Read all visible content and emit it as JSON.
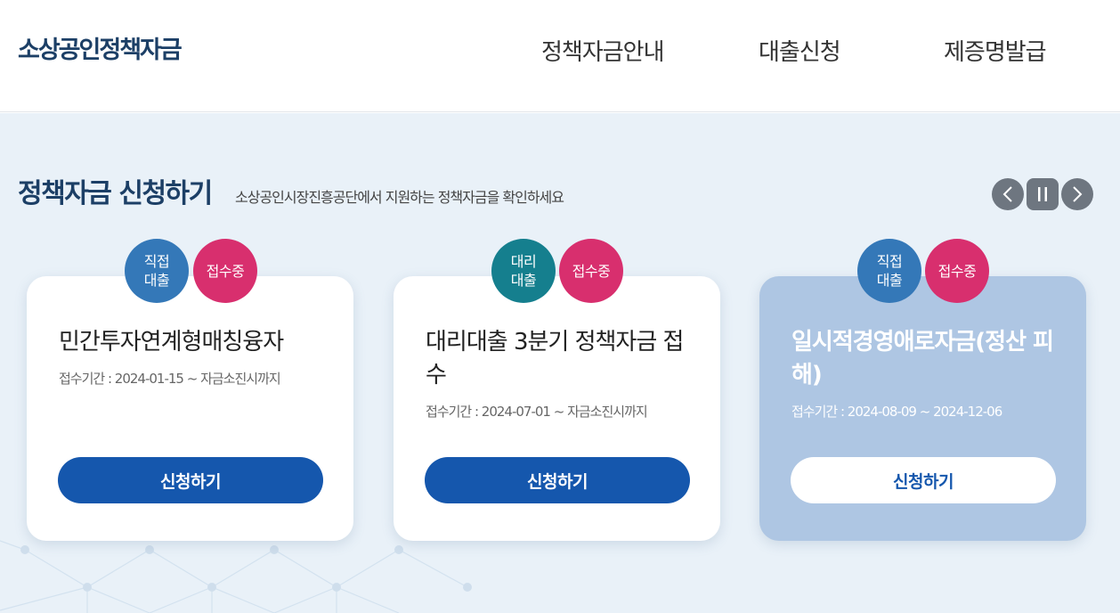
{
  "header": {
    "logo": "소상공인정책자금",
    "nav": [
      "정책자금안내",
      "대출신청",
      "제증명발급"
    ]
  },
  "section": {
    "title": "정책자금 신청하기",
    "subtitle": "소상공인시장진흥공단에서 지원하는 정책자금을 확인하세요"
  },
  "controls": {
    "prev_icon": "chevron-left-icon",
    "pause_icon": "pause-icon",
    "next_icon": "chevron-right-icon"
  },
  "cards": [
    {
      "type_line1": "직접",
      "type_line2": "대출",
      "status": "접수중",
      "title": "민간투자연계형매칭융자",
      "period": "접수기간 : 2024-01-15 ~ 자금소진시까지",
      "button": "신청하기"
    },
    {
      "type_line1": "대리",
      "type_line2": "대출",
      "status": "접수중",
      "title": "대리대출 3분기 정책자금 접수",
      "period": "접수기간 : 2024-07-01 ~ 자금소진시까지",
      "button": "신청하기"
    },
    {
      "type_line1": "직접",
      "type_line2": "대출",
      "status": "접수중",
      "title": "일시적경영애로자금(정산 피해)",
      "period": "접수기간 : 2024-08-09 ~ 2024-12-06",
      "button": "신청하기"
    }
  ],
  "colors": {
    "brand": "#1c3f66",
    "primary_button": "#1557ad",
    "direct_badge": "#3478b8",
    "proxy_badge": "#157f8e",
    "status_badge": "#d82f6e",
    "active_card": "#aec6e3",
    "section_bg": "#e9f1f8"
  }
}
